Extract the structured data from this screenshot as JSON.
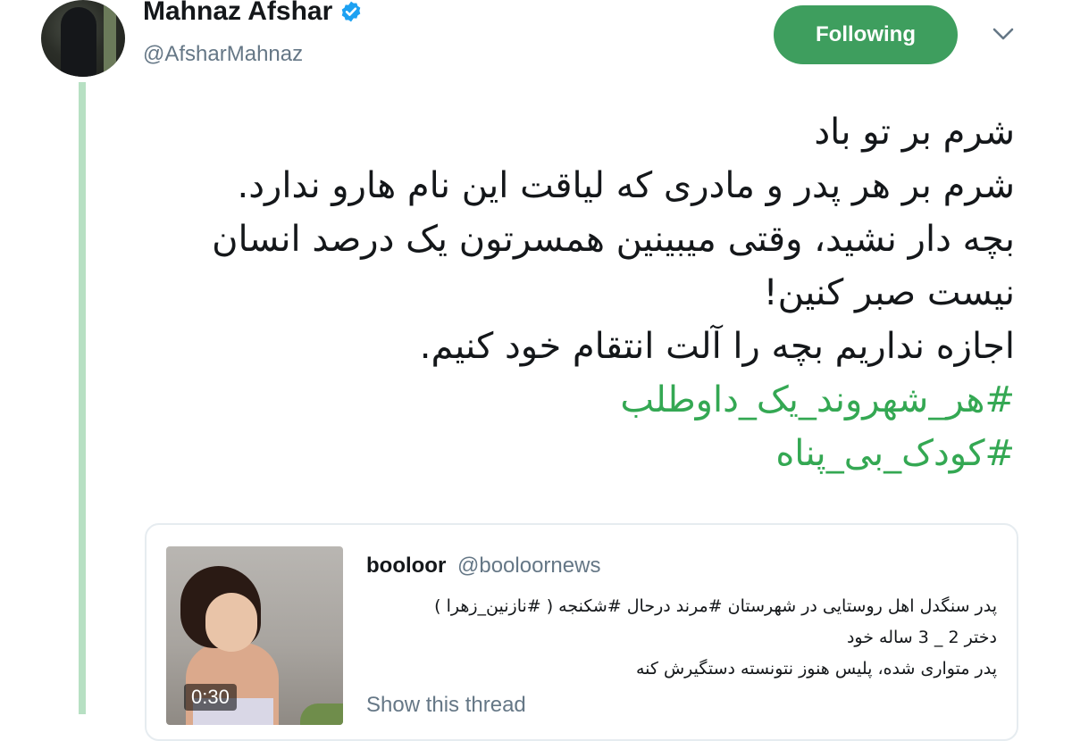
{
  "author": {
    "name": "Mahnaz Afshar",
    "handle": "@AfsharMahnaz",
    "verified": true
  },
  "follow_button": {
    "label": "Following"
  },
  "colors": {
    "accent_green": "#3e9e5e",
    "hashtag_green": "#34a853",
    "thread_line": "#b7e0c3",
    "muted": "#657786"
  },
  "tweet": {
    "lines": [
      "شرم بر تو باد",
      "شرم بر هر پدر و مادری که لیاقت این نام هارو ندارد.",
      "بچه دار نشید، وقتی میبینین همسرتون یک درصد انسان",
      "نیست صبر کنین!",
      "اجازه نداریم  بچه را آلت انتقام خود کنیم."
    ],
    "hashtags": [
      "#هر_شهروند_یک_داوطلب",
      "#کودک_بی_پناه"
    ]
  },
  "quoted_tweet": {
    "name": "booloor",
    "handle": "@booloornews",
    "lines": [
      "پدر سنگدل اهل روستایی در شهرستان #مرند درحال #شکنجه ( #نازنین_زهرا )",
      "دختر 2 _ 3 ساله خود",
      "پدر متواری شده، پلیس هنوز نتونسته دستگیرش کنه"
    ],
    "video_duration": "0:30",
    "show_thread_label": "Show this thread"
  }
}
